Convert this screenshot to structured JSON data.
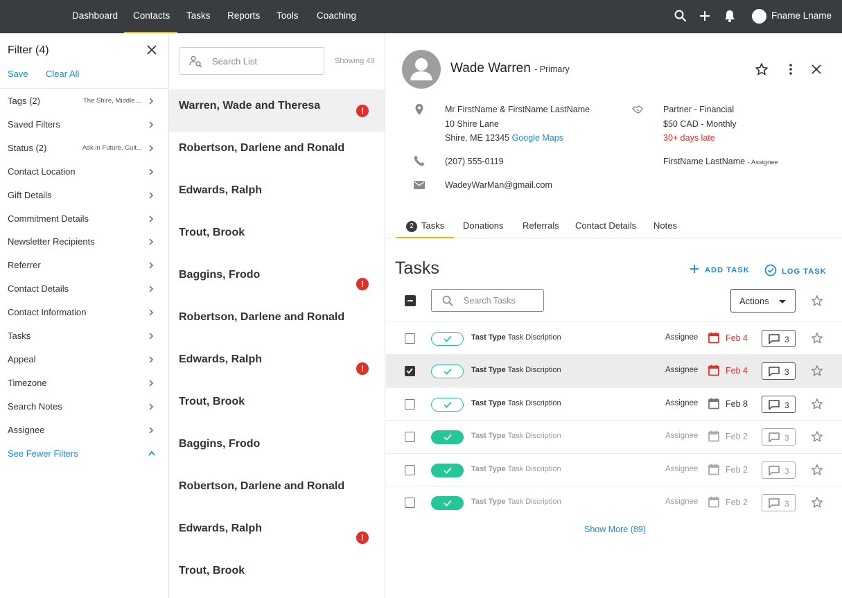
{
  "nav": {
    "items": [
      "Dashboard",
      "Contacts",
      "Tasks",
      "Reports",
      "Tools",
      "Coaching"
    ],
    "active": "Contacts",
    "user_name": "Fname Lname",
    "icons": [
      "search-icon",
      "plus-icon",
      "bell-icon"
    ]
  },
  "filter": {
    "title": "Filter (4)",
    "save_label": "Save",
    "clear_label": "Clear All",
    "rows": [
      {
        "label": "Tags (2)",
        "value": "The Shire, Middle ..."
      },
      {
        "label": "Saved Filters",
        "value": ""
      },
      {
        "label": "Status (2)",
        "value": "Ask in Future, Cult..."
      },
      {
        "label": "Contact Location",
        "value": ""
      },
      {
        "label": "Gift Details",
        "value": ""
      },
      {
        "label": "Commitment Details",
        "value": ""
      },
      {
        "label": "Newsletter Recipients",
        "value": ""
      },
      {
        "label": "Referrer",
        "value": ""
      },
      {
        "label": "Contact Details",
        "value": ""
      },
      {
        "label": "Contact Information",
        "value": ""
      },
      {
        "label": "Tasks",
        "value": ""
      },
      {
        "label": "Appeal",
        "value": ""
      },
      {
        "label": "Timezone",
        "value": ""
      },
      {
        "label": "Search Notes",
        "value": ""
      },
      {
        "label": "Assignee",
        "value": ""
      }
    ],
    "see_fewer_label": "See Fewer Filters"
  },
  "list": {
    "search_placeholder": "Search List",
    "showing": "Showing 43",
    "contacts": [
      {
        "name": "Warren, Wade and Theresa",
        "alert": true,
        "selected": true
      },
      {
        "name": "Robertson, Darlene and Ronald",
        "alert": false
      },
      {
        "name": "Edwards, Ralph",
        "alert": false
      },
      {
        "name": "Trout, Brook",
        "alert": false
      },
      {
        "name": "Baggins, Frodo",
        "alert": true
      },
      {
        "name": "Robertson, Darlene and Ronald",
        "alert": false
      },
      {
        "name": "Edwards, Ralph",
        "alert": true
      },
      {
        "name": "Trout, Brook",
        "alert": false
      },
      {
        "name": "Baggins, Frodo",
        "alert": false
      },
      {
        "name": "Robertson, Darlene and Ronald",
        "alert": false
      },
      {
        "name": "Edwards, Ralph",
        "alert": true
      },
      {
        "name": "Trout, Brook",
        "alert": false
      }
    ],
    "alert_glyph": "!"
  },
  "detail": {
    "name": "Wade Warren",
    "primary_label": "- Primary",
    "address": [
      "Mr FirstName & FirstName LastName",
      "10 Shire Lane",
      "Shire, ME 12345"
    ],
    "maps_link": "Google Maps",
    "partner": [
      "Partner - Financial",
      "$50 CAD - Monthly"
    ],
    "late": "30+ days late",
    "phone": "(207) 555-0119",
    "email": "WadeyWarMan@gmail.com",
    "assignee_name": "FirstName LastName",
    "assignee_label": "- Assignee"
  },
  "tabs": {
    "count": "2",
    "items": [
      "Tasks",
      "Donations",
      "Referrals",
      "Contact Details",
      "Notes"
    ],
    "active": "Tasks"
  },
  "tasks": {
    "title": "Tasks",
    "add_label": "ADD TASK",
    "log_label": "LOG TASK",
    "search_placeholder": "Search Tasks",
    "actions_label": "Actions",
    "type_label": "Tast Type",
    "desc_label": "Task Discription",
    "assignee_label": "Assignee",
    "rows": [
      {
        "checked": false,
        "done": false,
        "date": "Feb 4",
        "overdue": true,
        "comments": "3",
        "faded": false
      },
      {
        "checked": true,
        "done": false,
        "date": "Feb 4",
        "overdue": true,
        "comments": "3",
        "faded": false
      },
      {
        "checked": false,
        "done": false,
        "date": "Feb 8",
        "overdue": false,
        "comments": "3",
        "faded": false
      },
      {
        "checked": false,
        "done": true,
        "date": "Feb 2",
        "overdue": false,
        "comments": "3",
        "faded": true
      },
      {
        "checked": false,
        "done": true,
        "date": "Feb 2",
        "overdue": false,
        "comments": "3",
        "faded": true
      },
      {
        "checked": false,
        "done": true,
        "date": "Feb 2",
        "overdue": false,
        "comments": "3",
        "faded": true
      }
    ],
    "show_more": "Show More (89)"
  },
  "colors": {
    "nav_bg": "#3a3d40",
    "accent": "#f0b400",
    "link": "#1a8ad8",
    "alert": "#e0302a",
    "done": "#25c79a"
  }
}
